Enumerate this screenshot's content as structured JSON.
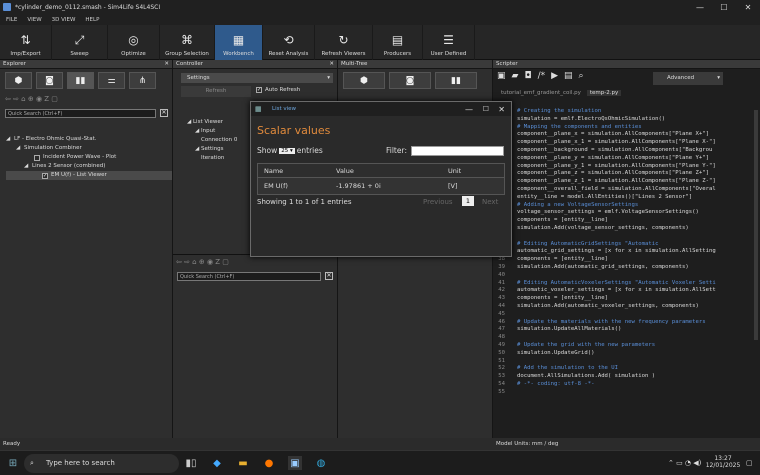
{
  "window": {
    "title": "*cylinder_demo_0112.smash - Sim4Life S4L4SCI"
  },
  "menu": [
    "FILE",
    "VIEW",
    "3D VIEW",
    "HELP"
  ],
  "toolbar": [
    {
      "label": "Imp/Export",
      "icon": "import-export-icon"
    },
    {
      "label": "Sweep",
      "icon": "sweep-icon"
    },
    {
      "label": "Optimize",
      "icon": "optimize-icon"
    },
    {
      "label": "Group Selection",
      "icon": "group-selection-icon"
    },
    {
      "label": "Workbench",
      "icon": "workbench-icon",
      "active": true
    },
    {
      "label": "Reset Analysis",
      "icon": "reset-analysis-icon"
    },
    {
      "label": "Refresh Viewers",
      "icon": "refresh-viewers-icon"
    },
    {
      "label": "Producers",
      "icon": "producers-icon"
    },
    {
      "label": "User Defined",
      "icon": "user-defined-icon"
    }
  ],
  "explorer": {
    "title": "Explorer",
    "search_placeholder": "Quick Search (Ctrl+F)",
    "tree": [
      {
        "label": "LF - Electro Ohmic Quasi-Stat.",
        "level": 0
      },
      {
        "label": "Simulation Combiner",
        "level": 1
      },
      {
        "label": "Incident Power Wave - Plot",
        "level": 2
      },
      {
        "label": "Lines 2 Sensor (combined)",
        "level": 1
      },
      {
        "label": "EM U(f) - List Viewer",
        "level": 2,
        "checked": true,
        "selected": true
      }
    ]
  },
  "controller": {
    "title": "Controller",
    "settings_label": "Settings",
    "refresh_label": "Refresh",
    "auto_refresh_label": "Auto Refresh",
    "search_placeholder": "Quick Search (Ctrl+F)",
    "tree": [
      "List Viewer",
      "Input",
      "Connection 0",
      "Settings",
      "Iteration"
    ]
  },
  "multitree": {
    "title": "Multi-Tree"
  },
  "dialog": {
    "window_title": "List view",
    "heading": "Scalar values",
    "show_label": "Show",
    "show_value": "25",
    "entries_label": "entries",
    "filter_label": "Filter:",
    "columns": [
      "Name",
      "Value",
      "Unit"
    ],
    "rows": [
      [
        "EM U(f)",
        "-1.97861 + 0i",
        "[V]"
      ]
    ],
    "info": "Showing 1 to 1 of 1 entries",
    "previous": "Previous",
    "page": "1",
    "next": "Next"
  },
  "scripter": {
    "title": "Scripter",
    "mode": "Advanced",
    "tabs": [
      "tutorial_emf_gradient_coil.py",
      "temp-2.py"
    ],
    "lines": [
      {
        "n": "",
        "t": "# Creating the simulation",
        "c": true
      },
      {
        "n": "",
        "t": "simulation = emlf.ElectroQsOhmicSimulation()"
      },
      {
        "n": "",
        "t": ""
      },
      {
        "n": "",
        "t": "# Mapping the components and entities",
        "c": true
      },
      {
        "n": "",
        "t": "component__plane_x = simulation.AllComponents[\"Plane X+\"]"
      },
      {
        "n": "",
        "t": "component__plane_x_1 = simulation.AllComponents[\"Plane X-\"]"
      },
      {
        "n": "",
        "t": "component__background = simulation.AllComponents[\"Backgrou"
      },
      {
        "n": "",
        "t": "component__plane_y = simulation.AllComponents[\"Plane Y+\"]"
      },
      {
        "n": "",
        "t": "component__plane_y_1 = simulation.AllComponents[\"Plane Y-\"]"
      },
      {
        "n": "",
        "t": "component__plane_z = simulation.AllComponents[\"Plane Z+\"]"
      },
      {
        "n": "",
        "t": "component__plane_z_1 = simulation.AllComponents[\"Plane Z-\"]"
      },
      {
        "n": "",
        "t": "component__overall_field = simulation.AllComponents[\"Overal"
      },
      {
        "n": "",
        "t": ""
      },
      {
        "n": "",
        "t": "entity__line = model.AllEntities()[\"Lines 2 Sensor\"]"
      },
      {
        "n": "",
        "t": ""
      },
      {
        "n": "",
        "t": "# Adding a new VoltageSensorSettings",
        "c": true
      },
      {
        "n": "",
        "t": "voltage_sensor_settings = emlf.VoltageSensorSettings()"
      },
      {
        "n": "",
        "t": "components = [entity__line]"
      },
      {
        "n": "",
        "t": "simulation.Add(voltage_sensor_settings, components)"
      },
      {
        "n": "35",
        "t": ""
      },
      {
        "n": "36",
        "t": "# Editing AutomaticGridSettings \"Automatic",
        "c": true
      },
      {
        "n": "37",
        "t": "automatic_grid_settings = [x for x in simulation.AllSetting"
      },
      {
        "n": "38",
        "t": "components = [entity__line]"
      },
      {
        "n": "39",
        "t": "simulation.Add(automatic_grid_settings, components)"
      },
      {
        "n": "40",
        "t": ""
      },
      {
        "n": "41",
        "t": "# Editing AutomaticVoxelerSettings \"Automatic Voxeler Setti",
        "c": true
      },
      {
        "n": "42",
        "t": "automatic_voxeler_settings = [x for x in simulation.AllSett"
      },
      {
        "n": "43",
        "t": "components = [entity__line]"
      },
      {
        "n": "44",
        "t": "simulation.Add(automatic_voxeler_settings, components)"
      },
      {
        "n": "45",
        "t": ""
      },
      {
        "n": "46",
        "t": "# Update the materials with the new frequency parameters",
        "c": true
      },
      {
        "n": "47",
        "t": "simulation.UpdateAllMaterials()"
      },
      {
        "n": "48",
        "t": ""
      },
      {
        "n": "49",
        "t": "# Update the grid with the new parameters",
        "c": true
      },
      {
        "n": "50",
        "t": "simulation.UpdateGrid()"
      },
      {
        "n": "51",
        "t": ""
      },
      {
        "n": "52",
        "t": "# Add the simulation to the UI",
        "c": true
      },
      {
        "n": "53",
        "t": "document.AllSimulations.Add( simulation )"
      },
      {
        "n": "54",
        "t": "# -*- coding: utf-8 -*-",
        "c": true
      },
      {
        "n": "55",
        "t": ""
      }
    ]
  },
  "status": {
    "left": "Ready",
    "units": "Model Units: mm / deg"
  },
  "taskbar": {
    "search_placeholder": "Type here to search",
    "time": "13:27",
    "date": "12/01/2025"
  },
  "colors": {
    "accent": "#2f5a8c",
    "heading": "#e08a3c",
    "link": "#6fa8e0"
  }
}
